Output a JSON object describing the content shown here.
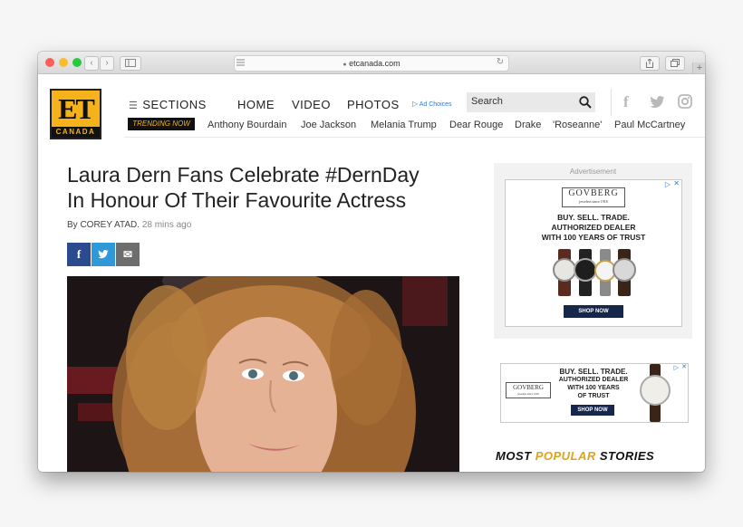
{
  "browser": {
    "url": "etcanada.com",
    "back_icon": "chevron-left-icon",
    "forward_icon": "chevron-right-icon",
    "new_tab_label": "+"
  },
  "site": {
    "logo_text": "ET",
    "logo_subtext": "CANADA",
    "sections_label": "SECTIONS",
    "nav": [
      "HOME",
      "VIDEO",
      "PHOTOS"
    ],
    "ad_choices": "Ad Choices",
    "search_placeholder": "Search",
    "trending_label": "TRENDING NOW",
    "trending": [
      "Anthony Bourdain",
      "Joe Jackson",
      "Melania Trump",
      "Dear Rouge",
      "Drake",
      "'Roseanne'",
      "Paul McCartney"
    ],
    "brand_color": "#f5b21a"
  },
  "article": {
    "title_line1": "Laura Dern Fans Celebrate #DernDay",
    "title_line2": "In Honour Of Their Favourite Actress",
    "by": "By",
    "author": "COREY ATAD.",
    "time": "28 mins ago",
    "share_facebook": "f",
    "share_twitter": "t",
    "share_email": "✉"
  },
  "ads": {
    "label": "Advertisement",
    "brand": "GOVBERG",
    "brand_sub": "jewelers since 1916",
    "line1": "BUY. SELL. TRADE.",
    "line2": "AUTHORIZED DEALER",
    "line3": "WITH 100 YEARS OF TRUST",
    "small_line1": "BUY. SELL. TRADE.",
    "small_line2": "AUTHORIZED DEALER",
    "small_line3": "WITH 100 YEARS",
    "small_line4": "OF TRUST",
    "cta": "SHOP NOW"
  },
  "sidebar": {
    "most": "MOST",
    "popular": "POPULAR",
    "stories": "STORIES"
  }
}
